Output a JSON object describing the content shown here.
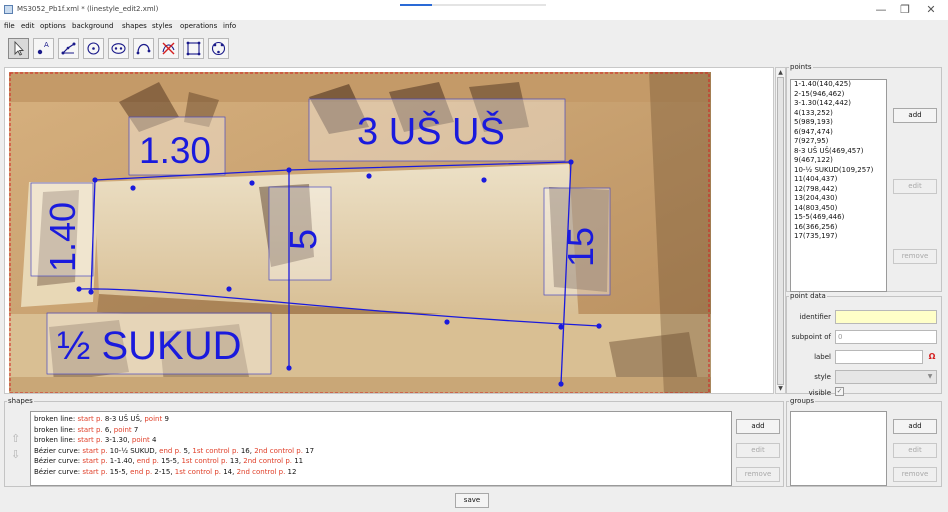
{
  "window": {
    "title": "MS3052_Pb1f.xml * (linestyle_edit2.xml)",
    "minimize_glyph": "—",
    "maximize_glyph": "❐",
    "close_glyph": "✕"
  },
  "menu": [
    "file",
    "edit",
    "options",
    "background",
    "shapes",
    "styles",
    "operations",
    "info"
  ],
  "tools": [
    "select-tool",
    "add-point-tool",
    "broken-line-tool",
    "circle-tool",
    "ellipse-tool",
    "bezier-curve-tool",
    "delete-tool",
    "rectangle-tool",
    "ellipse-points-tool"
  ],
  "overlay_labels": [
    "1.30",
    "3 UŠ UŠ",
    "1.40",
    "5",
    "15",
    "½ SUKUD"
  ],
  "points": {
    "legend": "points",
    "items": [
      "1-1.40(140,425)",
      "2-15(946,462)",
      "3-1.30(142,442)",
      "4(133,252)",
      "5(989,193)",
      "6(947,474)",
      "7(927,95)",
      "8-3 UŠ UŠ(469,457)",
      "9(467,122)",
      "10-½ SUKUD(109,257)",
      "11(404,437)",
      "12(798,442)",
      "13(204,430)",
      "14(803,450)",
      "15-5(469,446)",
      "16(366,256)",
      "17(735,197)"
    ],
    "add": "add",
    "edit": "edit",
    "remove": "remove"
  },
  "point_data": {
    "legend": "point data",
    "identifier_label": "identifier",
    "subpoint_label": "subpoint of",
    "subpoint_value": "0",
    "label_label": "label",
    "style_label": "style",
    "visible_label": "visible",
    "visible_checked": true
  },
  "shapes": {
    "legend": "shapes",
    "lines": [
      [
        {
          "t": "broken line: ",
          "h": false
        },
        {
          "t": "start p.",
          "h": true
        },
        {
          "t": " 8-3 UŠ UŠ, ",
          "h": false
        },
        {
          "t": "point",
          "h": true
        },
        {
          "t": " 9",
          "h": false
        }
      ],
      [
        {
          "t": "broken line: ",
          "h": false
        },
        {
          "t": "start p.",
          "h": true
        },
        {
          "t": " 6, ",
          "h": false
        },
        {
          "t": "point",
          "h": true
        },
        {
          "t": " 7",
          "h": false
        }
      ],
      [
        {
          "t": "broken line: ",
          "h": false
        },
        {
          "t": "start p.",
          "h": true
        },
        {
          "t": " 3-1.30, ",
          "h": false
        },
        {
          "t": "point",
          "h": true
        },
        {
          "t": " 4",
          "h": false
        }
      ],
      [
        {
          "t": "Bézier curve: ",
          "h": false
        },
        {
          "t": "start p.",
          "h": true
        },
        {
          "t": " 10-½ SUKUD, ",
          "h": false
        },
        {
          "t": "end p.",
          "h": true
        },
        {
          "t": " 5, ",
          "h": false
        },
        {
          "t": "1st control p.",
          "h": true
        },
        {
          "t": " 16, ",
          "h": false
        },
        {
          "t": "2nd control p.",
          "h": true
        },
        {
          "t": " 17",
          "h": false
        }
      ],
      [
        {
          "t": "Bézier curve: ",
          "h": false
        },
        {
          "t": "start p.",
          "h": true
        },
        {
          "t": " 1-1.40, ",
          "h": false
        },
        {
          "t": "end p.",
          "h": true
        },
        {
          "t": " 15-5, ",
          "h": false
        },
        {
          "t": "1st control p.",
          "h": true
        },
        {
          "t": " 13, ",
          "h": false
        },
        {
          "t": "2nd control p.",
          "h": true
        },
        {
          "t": " 11",
          "h": false
        }
      ],
      [
        {
          "t": "Bézier curve: ",
          "h": false
        },
        {
          "t": "start p.",
          "h": true
        },
        {
          "t": " 15-5, ",
          "h": false
        },
        {
          "t": "end p.",
          "h": true
        },
        {
          "t": " 2-15, ",
          "h": false
        },
        {
          "t": "1st control p.",
          "h": true
        },
        {
          "t": " 14, ",
          "h": false
        },
        {
          "t": "2nd control p.",
          "h": true
        },
        {
          "t": " 12",
          "h": false
        }
      ]
    ],
    "up_arrow": "⇧",
    "down_arrow": "⇩",
    "add": "add",
    "edit": "edit",
    "remove": "remove"
  },
  "groups": {
    "legend": "groups",
    "add": "add",
    "edit": "edit",
    "remove": "remove"
  },
  "save": "save",
  "colors": {
    "overlay": "#1a1add",
    "highlight": "#e0402a",
    "selection_border": "#d42020",
    "identifier_bg": "#ffffc8"
  }
}
